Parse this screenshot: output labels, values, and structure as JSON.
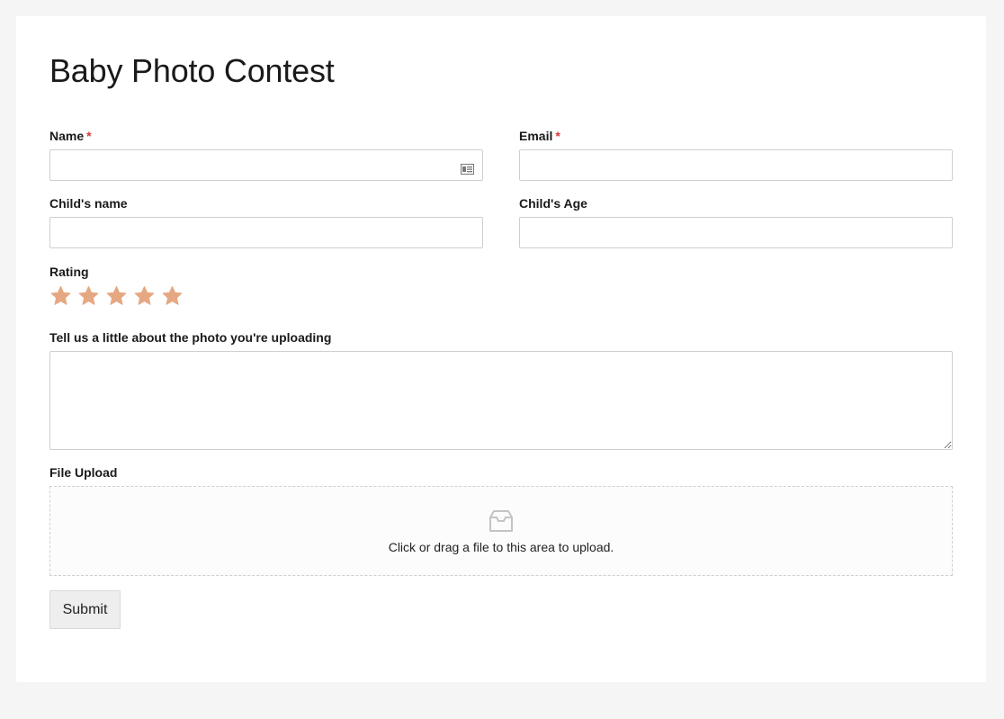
{
  "form": {
    "title": "Baby Photo Contest",
    "required_marker": "*",
    "fields": {
      "name": {
        "label": "Name",
        "value": "",
        "required": true
      },
      "email": {
        "label": "Email",
        "value": "",
        "required": true
      },
      "child_name": {
        "label": "Child's name",
        "value": ""
      },
      "child_age": {
        "label": "Child's Age",
        "value": ""
      },
      "rating": {
        "label": "Rating",
        "max_stars": 5,
        "value": 0,
        "star_color": "#e6a882"
      },
      "about_photo": {
        "label": "Tell us a little about the photo you're uploading",
        "value": ""
      },
      "file_upload": {
        "label": "File Upload",
        "dropzone_text": "Click or drag a file to this area to upload.",
        "icon": "inbox-tray-icon"
      }
    },
    "submit_label": "Submit"
  },
  "colors": {
    "page_bg": "#f5f5f5",
    "card_bg": "#ffffff",
    "required": "#d63638",
    "border": "#cfcfcf"
  }
}
